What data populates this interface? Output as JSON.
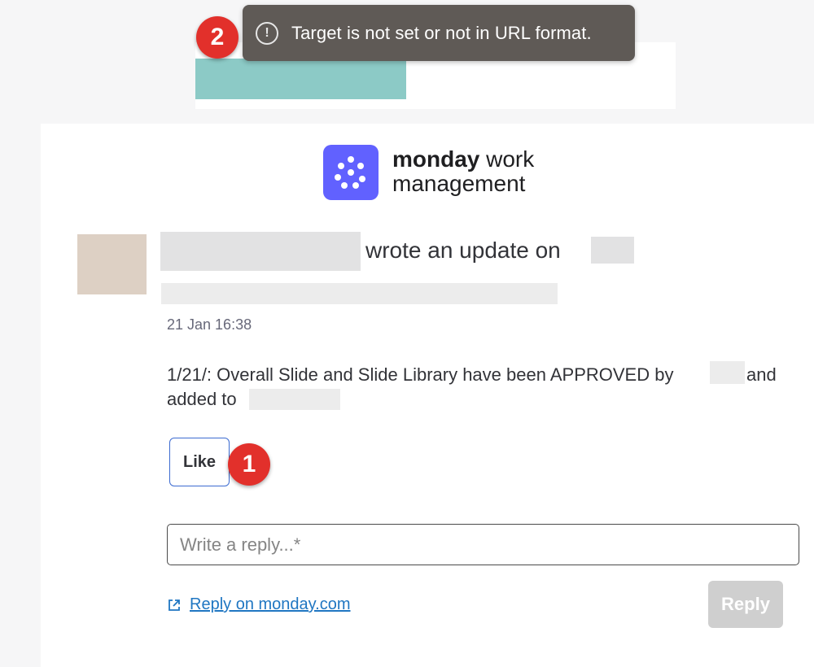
{
  "toast": {
    "message": "Target is not set or not in URL format.",
    "icon": "info-circle-icon"
  },
  "badges": {
    "first": "1",
    "second": "2"
  },
  "logo": {
    "brand": "monday",
    "suffix_line1": "work",
    "line2": "management",
    "color": "#6161ff"
  },
  "update": {
    "action_text": "wrote an update on",
    "timestamp": "21 Jan 16:38",
    "body_part1": "1/21/: Overall Slide and Slide Library have been APPROVED by",
    "body_part2": "and",
    "body_part3": "added to"
  },
  "actions": {
    "like_label": "Like",
    "reply_placeholder": "Write a reply...*",
    "reply_link": "Reply on monday.com",
    "reply_button": "Reply"
  }
}
